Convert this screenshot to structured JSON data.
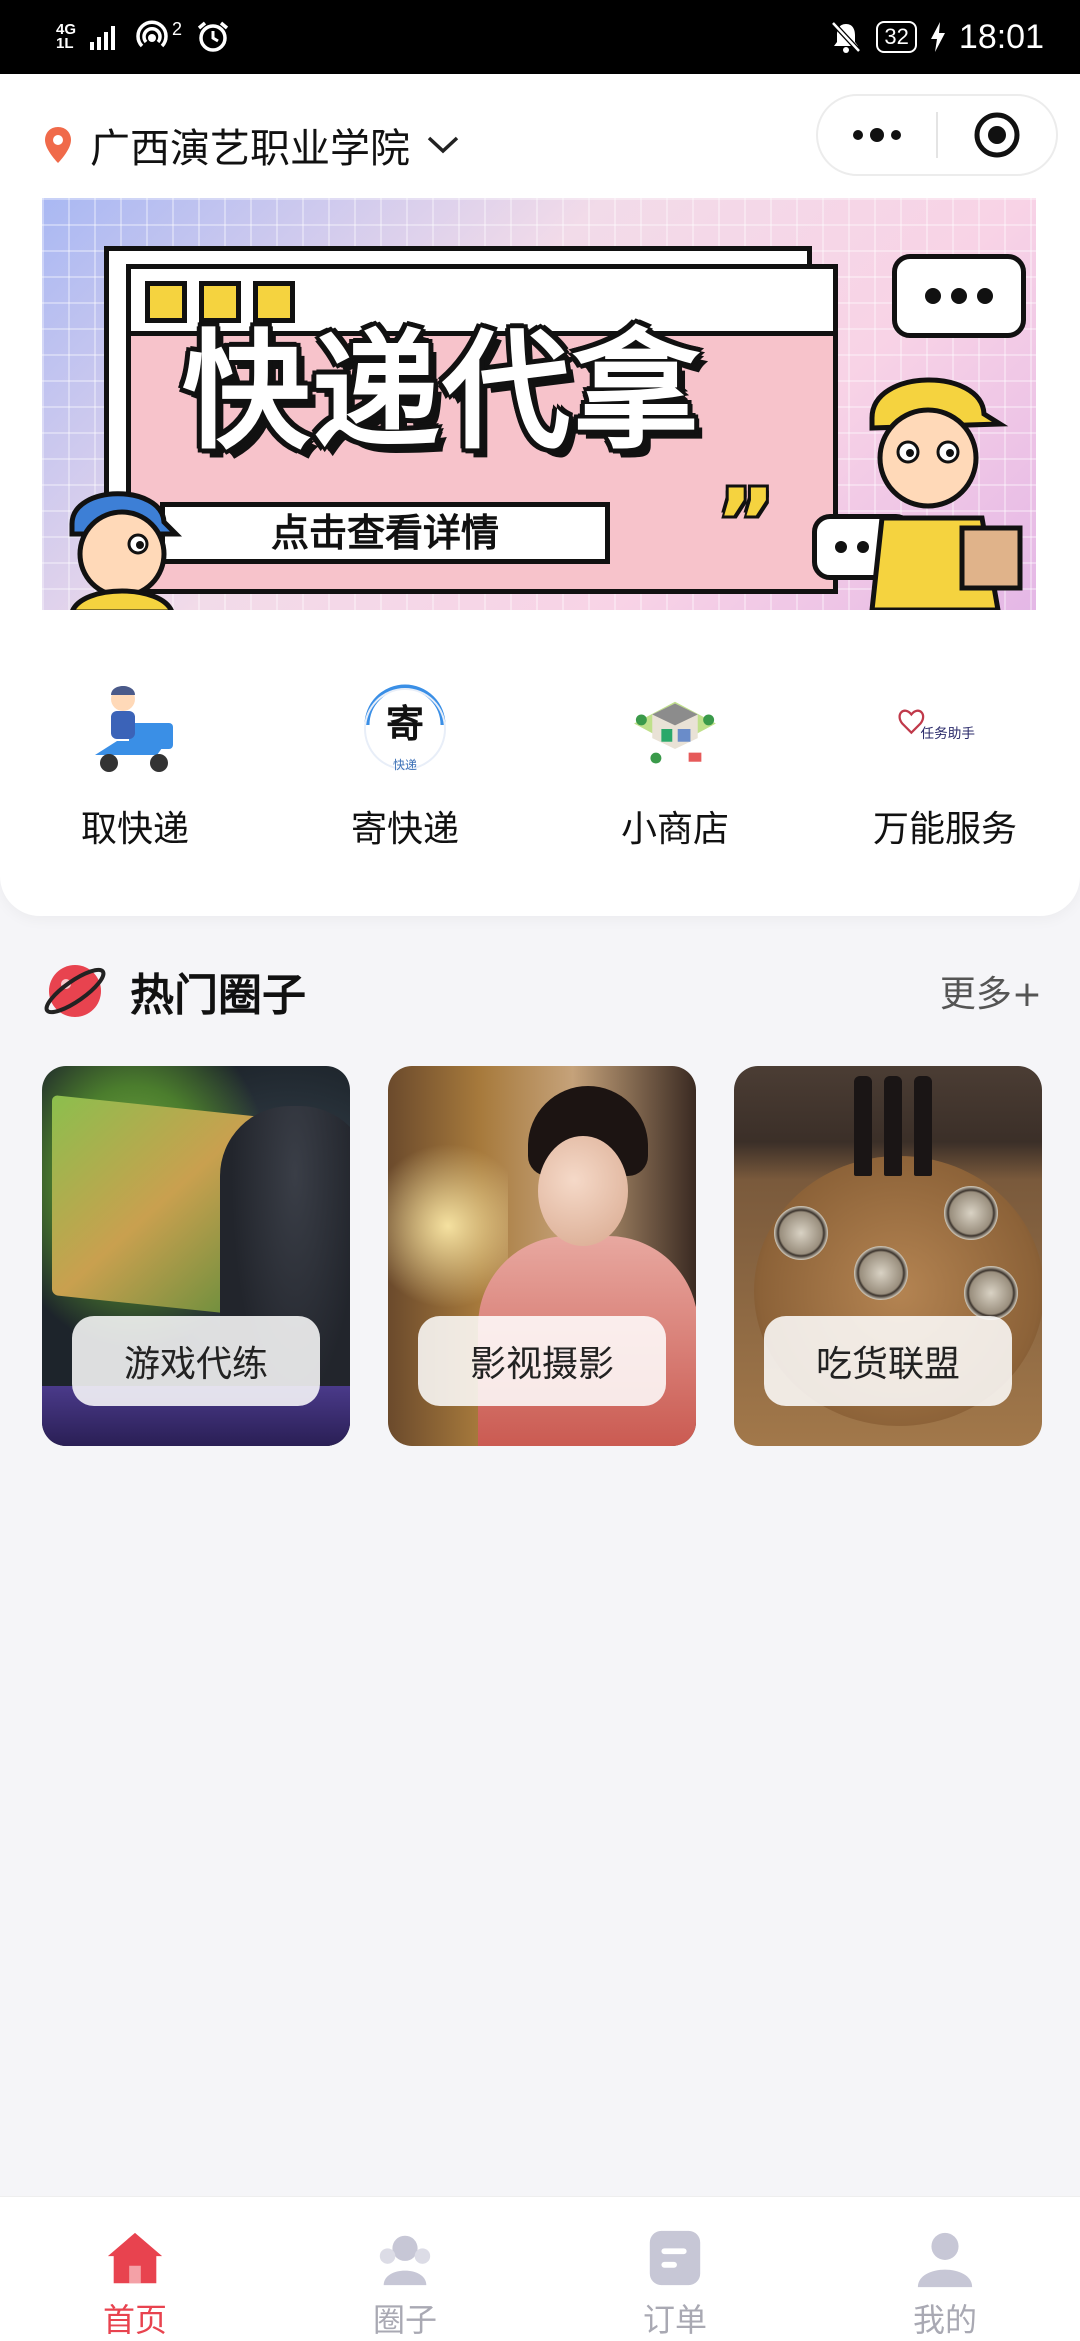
{
  "status_bar": {
    "network_top": "4G",
    "network_bottom": "1L",
    "hotspot_count": "2",
    "battery": "32",
    "time": "18:01"
  },
  "header": {
    "location": "广西演艺职业学院"
  },
  "banner": {
    "title": "快递代拿",
    "subtitle": "点击查看详情"
  },
  "services": [
    {
      "label": "取快递",
      "icon": "courier-pickup-icon"
    },
    {
      "label": "寄快递",
      "icon": "send-package-icon",
      "icon_text": "寄",
      "icon_subtext": "快递"
    },
    {
      "label": "小商店",
      "icon": "shop-icon"
    },
    {
      "label": "万能服务",
      "icon": "task-helper-icon",
      "icon_text": "任务助手"
    }
  ],
  "hot_circles": {
    "title": "热门圈子",
    "more": "更多+",
    "items": [
      {
        "label": "游戏代练"
      },
      {
        "label": "影视摄影"
      },
      {
        "label": "吃货联盟"
      }
    ]
  },
  "tabbar": {
    "items": [
      {
        "label": "首页",
        "active": true
      },
      {
        "label": "圈子",
        "active": false
      },
      {
        "label": "订单",
        "active": false
      },
      {
        "label": "我的",
        "active": false
      }
    ]
  },
  "colors": {
    "accent": "#e8434f",
    "inactive": "#a9a9b3",
    "location_pin": "#f06a4a"
  }
}
